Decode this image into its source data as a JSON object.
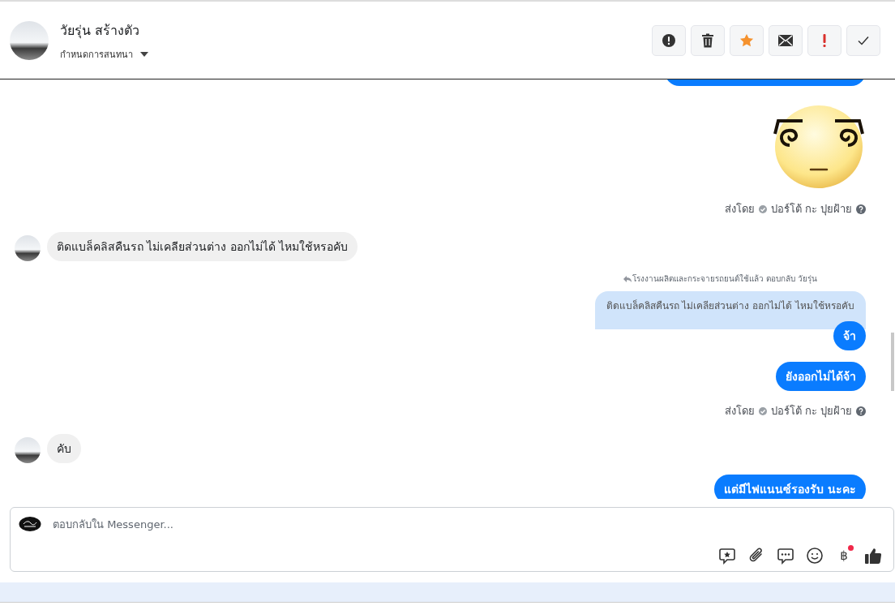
{
  "header": {
    "name": "วัยรุ่น สร้างตัว",
    "subtitle": "กำหนดการสนทนา"
  },
  "messages": [
    {
      "kind": "clipped"
    },
    {
      "kind": "sticker"
    },
    {
      "kind": "sent_by",
      "label": "ส่งโดย",
      "sender": "ปอร์โต้ กะ ปุยฝ้าย"
    },
    {
      "kind": "incoming",
      "text": "ติดแบล็คลิสคืนรถ ไม่เคลียส่วนต่าง  ออกไม่ได้  ไหมใช้หรอคับ"
    },
    {
      "kind": "reply",
      "header": "โรงงานผลิตและกระจายรถยนต์ใช้แล้ว ตอบกลับ วัยรุ่น",
      "quote": "ติดแบล็คลิสคืนรถ ไม่เคลียส่วนต่าง ออกไม่ได้ ไหมใช้หรอคับ",
      "text": "จ้า"
    },
    {
      "kind": "outgoing",
      "text": "ยังออกไม่ได้จ้า"
    },
    {
      "kind": "sent_by",
      "label": "ส่งโดย",
      "sender": "ปอร์โต้ กะ ปุยฝ้าย"
    },
    {
      "kind": "incoming",
      "text": "คับ"
    },
    {
      "kind": "outgoing",
      "text": "แต่มีไฟแนนซ์รองรับ นะคะ"
    }
  ],
  "composer": {
    "placeholder": "ตอบกลับใน Messenger...",
    "currency_symbol": "฿",
    "currency_badge": true
  }
}
